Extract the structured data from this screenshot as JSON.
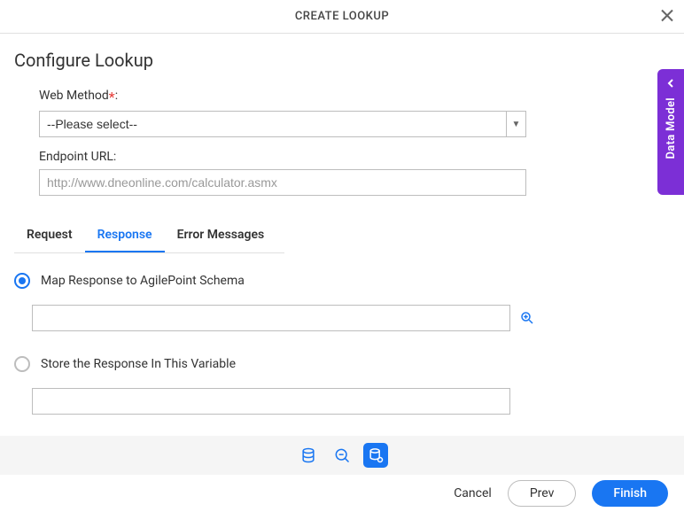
{
  "header": {
    "title": "CREATE LOOKUP"
  },
  "page": {
    "title": "Configure Lookup"
  },
  "form": {
    "web_method_label": "Web Method",
    "web_method_colon": ":",
    "web_method_placeholder": "--Please select--",
    "endpoint_label": "Endpoint URL:",
    "endpoint_value": "http://www.dneonline.com/calculator.asmx"
  },
  "tabs": {
    "request": "Request",
    "response": "Response",
    "errors": "Error Messages"
  },
  "options": {
    "map_schema": "Map Response to AgilePoint Schema",
    "store_variable": "Store the Response In This Variable"
  },
  "footer": {
    "cancel": "Cancel",
    "prev": "Prev",
    "finish": "Finish"
  },
  "side": {
    "label": "Data Model"
  }
}
